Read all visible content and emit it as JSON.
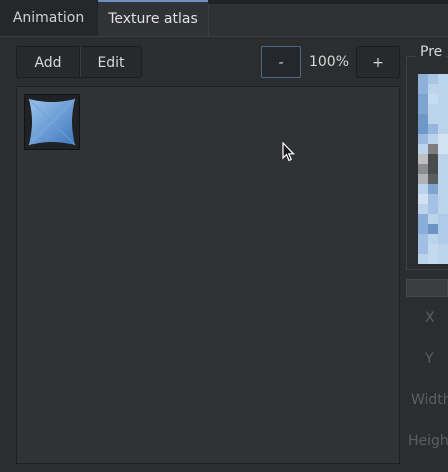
{
  "tabs": [
    {
      "label": "Animation",
      "active": false
    },
    {
      "label": "Texture atlas",
      "active": true
    }
  ],
  "toolbar": {
    "add_label": "Add",
    "edit_label": "Edit",
    "zoom_out_label": "-",
    "zoom_level": "100%",
    "zoom_in_label": "+"
  },
  "atlas": {
    "items": [
      {
        "icon": "texture-thumbnail-icon"
      }
    ]
  },
  "preview": {
    "label": "Pre"
  },
  "properties": {
    "x_label": "X",
    "y_label": "Y",
    "width_label": "Width",
    "height_label": "Heigh"
  },
  "colors": {
    "accent": "#6c93c6",
    "background": "#2b2d2f",
    "panel": "#303235",
    "disabled_text": "#5c5f62"
  }
}
